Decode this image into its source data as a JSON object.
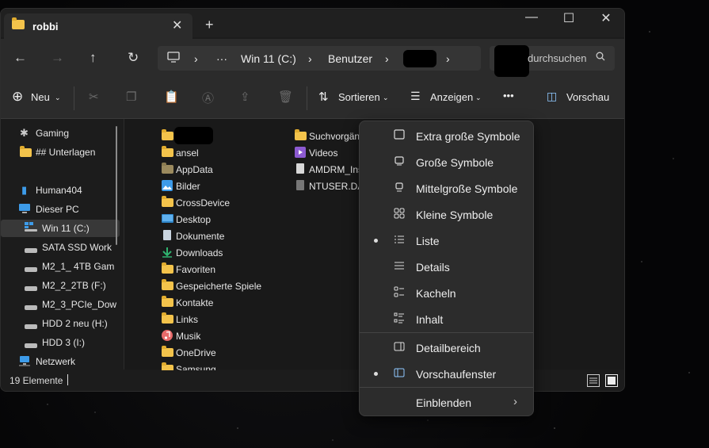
{
  "window": {
    "tab_title": "robbi",
    "new_tab": "+",
    "tab_close": "✕",
    "minimize": "—",
    "maximize": "☐",
    "close": "✕"
  },
  "navigation": {
    "back": "←",
    "forward": "→",
    "up": "↑",
    "refresh": "↻",
    "breadcrumb": [
      "Win 11  (C:)",
      "Benutzer"
    ],
    "ellipsis": "···",
    "chevron": "›",
    "search_placeholder": "durchsuchen"
  },
  "toolbar": {
    "new_label": "Neu",
    "sort_label": "Sortieren",
    "view_label": "Anzeigen",
    "more_label": "•••",
    "preview_label": "Vorschau"
  },
  "sidebar": {
    "items": [
      {
        "label": "Gaming",
        "icon": "⚙"
      },
      {
        "label": "## Unterlagen",
        "icon": "folder"
      },
      {
        "label": "Human404",
        "icon": "▮"
      },
      {
        "label": "Dieser PC",
        "icon": "🖥"
      },
      {
        "label": "Win 11  (C:)",
        "icon": "drive"
      },
      {
        "label": "SATA SSD Work",
        "icon": "drive"
      },
      {
        "label": "M2_1_ 4TB Gam",
        "icon": "drive"
      },
      {
        "label": "M2_2_2TB (F:)",
        "icon": "drive"
      },
      {
        "label": "M2_3_PCIe_Dow",
        "icon": "drive"
      },
      {
        "label": "HDD 2 neu (H:)",
        "icon": "drive"
      },
      {
        "label": "HDD 3 (I:)",
        "icon": "drive"
      },
      {
        "label": "Netzwerk",
        "icon": "🖧"
      }
    ]
  },
  "files": {
    "col1": [
      {
        "name": "",
        "icon": "folder"
      },
      {
        "name": "ansel",
        "icon": "folder"
      },
      {
        "name": "AppData",
        "icon": "folder-dim"
      },
      {
        "name": "Bilder",
        "icon": "image"
      },
      {
        "name": "CrossDevice",
        "icon": "folder"
      },
      {
        "name": "Desktop",
        "icon": "desktop"
      },
      {
        "name": "Dokumente",
        "icon": "document"
      },
      {
        "name": "Downloads",
        "icon": "download"
      },
      {
        "name": "Favoriten",
        "icon": "folder"
      },
      {
        "name": "Gespeicherte Spiele",
        "icon": "folder"
      },
      {
        "name": "Kontakte",
        "icon": "folder"
      },
      {
        "name": "Links",
        "icon": "folder"
      },
      {
        "name": "Musik",
        "icon": "music"
      },
      {
        "name": "OneDrive",
        "icon": "folder"
      },
      {
        "name": "Samsung",
        "icon": "folder"
      }
    ],
    "col2": [
      {
        "name": "Suchvorgän",
        "icon": "folder"
      },
      {
        "name": "Videos",
        "icon": "video"
      },
      {
        "name": "AMDRM_Ins",
        "icon": "document"
      },
      {
        "name": "NTUSER.DAT",
        "icon": "document-grey"
      }
    ]
  },
  "status": {
    "count": "19 Elemente"
  },
  "view_menu": {
    "items": [
      {
        "label": "Extra große Symbole",
        "icon": "▭",
        "selected": false
      },
      {
        "label": "Große Symbole",
        "icon": "▭",
        "selected": false
      },
      {
        "label": "Mittelgroße Symbole",
        "icon": "▯",
        "selected": false
      },
      {
        "label": "Kleine Symbole",
        "icon": "⠿",
        "selected": false
      },
      {
        "label": "Liste",
        "icon": "☰",
        "selected": true
      },
      {
        "label": "Details",
        "icon": "☰",
        "selected": false
      },
      {
        "label": "Kacheln",
        "icon": "☷",
        "selected": false
      },
      {
        "label": "Inhalt",
        "icon": "☷",
        "selected": false
      },
      {
        "label": "Detailbereich",
        "icon": "◫",
        "selected": false
      },
      {
        "label": "Vorschaufenster",
        "icon": "◫",
        "selected": true
      },
      {
        "label": "Einblenden",
        "icon": "",
        "selected": false,
        "submenu": true
      }
    ]
  }
}
